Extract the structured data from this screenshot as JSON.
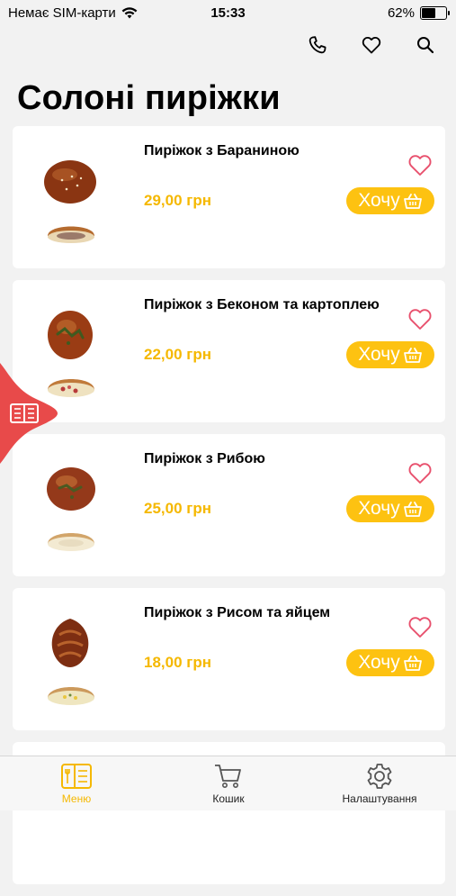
{
  "status": {
    "carrier": "Немає SIM-карти",
    "time": "15:33",
    "battery": "62%",
    "battery_level": 0.62
  },
  "header": {
    "icons": [
      "phone-icon",
      "heart-icon",
      "search-icon"
    ]
  },
  "page": {
    "title": "Солоні пиріжки"
  },
  "products": [
    {
      "name": "Пиріжок з Бараниною",
      "price": "29,00 грн",
      "button": "Хочу"
    },
    {
      "name": "Пиріжок з Беконом та картоплею",
      "price": "22,00 грн",
      "button": "Хочу"
    },
    {
      "name": "Пиріжок з Рибою",
      "price": "25,00 грн",
      "button": "Хочу"
    },
    {
      "name": "Пиріжок з Рисом та яйцем",
      "price": "18,00 грн",
      "button": "Хочу"
    }
  ],
  "nav": {
    "menu": "Меню",
    "cart": "Кошик",
    "settings": "Налаштування"
  },
  "colors": {
    "accent": "#fdc211",
    "price": "#f5b800",
    "heart": "#e8506d",
    "side_tab": "#e84a4a",
    "background": "#f2f2f2"
  }
}
